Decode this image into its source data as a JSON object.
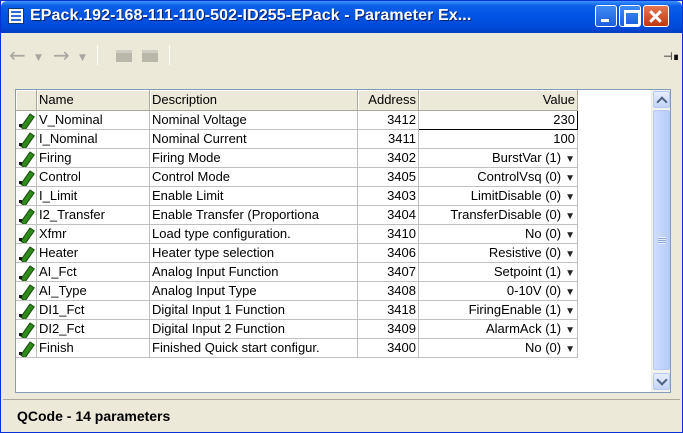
{
  "window": {
    "title": "EPack.192-168-111-110-502-ID255-EPack - Parameter Ex..."
  },
  "table": {
    "headers": [
      "Name",
      "Description",
      "Address",
      "Value"
    ],
    "rows": [
      {
        "name": "V_Nominal",
        "description": "Nominal Voltage",
        "address": "3412",
        "value": "230",
        "dropdown": false
      },
      {
        "name": "I_Nominal",
        "description": "Nominal Current",
        "address": "3411",
        "value": "100",
        "dropdown": false
      },
      {
        "name": "Firing",
        "description": "Firing Mode",
        "address": "3402",
        "value": "BurstVar (1)",
        "dropdown": true
      },
      {
        "name": "Control",
        "description": "Control Mode",
        "address": "3405",
        "value": "ControlVsq (0)",
        "dropdown": true
      },
      {
        "name": "I_Limit",
        "description": "Enable Limit",
        "address": "3403",
        "value": "LimitDisable (0)",
        "dropdown": true
      },
      {
        "name": "I2_Transfer",
        "description": "Enable Transfer (Proportiona",
        "address": "3404",
        "value": "TransferDisable (0)",
        "dropdown": true
      },
      {
        "name": "Xfmr",
        "description": "Load type configuration.",
        "address": "3410",
        "value": "No (0)",
        "dropdown": true
      },
      {
        "name": "Heater",
        "description": "Heater type selection",
        "address": "3406",
        "value": "Resistive (0)",
        "dropdown": true
      },
      {
        "name": "AI_Fct",
        "description": "Analog Input Function",
        "address": "3407",
        "value": "Setpoint (1)",
        "dropdown": true
      },
      {
        "name": "AI_Type",
        "description": "Analog Input Type",
        "address": "3408",
        "value": "0-10V (0)",
        "dropdown": true
      },
      {
        "name": "DI1_Fct",
        "description": "Digital Input 1 Function",
        "address": "3418",
        "value": "FiringEnable (1)",
        "dropdown": true
      },
      {
        "name": "DI2_Fct",
        "description": "Digital Input 2 Function",
        "address": "3409",
        "value": "AlarmAck (1)",
        "dropdown": true
      },
      {
        "name": "Finish",
        "description": "Finished Quick start configur.",
        "address": "3400",
        "value": "No (0)",
        "dropdown": true
      }
    ]
  },
  "status": {
    "text": "QCode  -  14 parameters"
  },
  "icons": {
    "app": "table-icon",
    "back": "arrow-left-icon",
    "forward": "arrow-right-icon",
    "folder": "folder-icon",
    "pin": "pin-icon",
    "row": "pencil-icon",
    "dropdown": "dropdown-arrow-icon"
  },
  "colors": {
    "titlebar": "#0054e3",
    "pencil": "#2f8a1c",
    "window_bg": "#ece9d8"
  }
}
